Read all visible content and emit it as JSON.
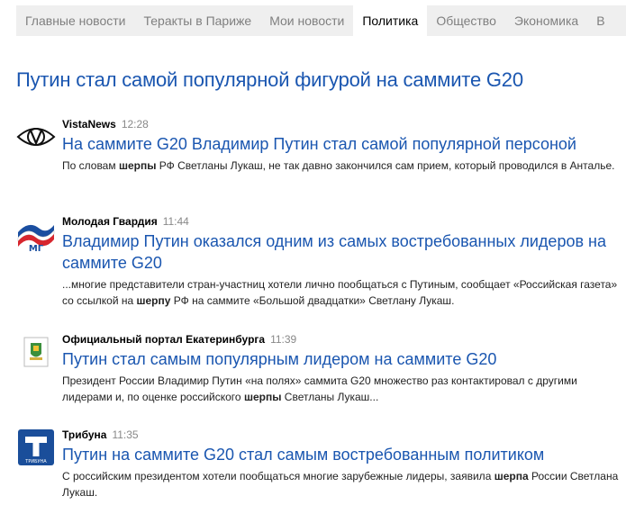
{
  "tabs": [
    {
      "label": "Главные новости",
      "active": false
    },
    {
      "label": "Теракты в Париже",
      "active": false
    },
    {
      "label": "Мои новости",
      "active": false
    },
    {
      "label": "Политика",
      "active": true
    },
    {
      "label": "Общество",
      "active": false
    },
    {
      "label": "Экономика",
      "active": false
    },
    {
      "label": "В",
      "active": false
    }
  ],
  "headline": "Путин стал самой популярной фигурой на саммите G20",
  "stories": [
    {
      "logo": "vistanews-eye-logo",
      "source": "VistaNews",
      "time": "12:28",
      "title": "На саммите G20 Владимир Путин стал самой популярной персоной",
      "snippet": {
        "a": "По словам ",
        "b": "шерпы",
        "c": " РФ Светланы Лукаш, не так давно закончился сам прием, который проводился в Анталье."
      }
    },
    {
      "logo": "molodaya-gvardiya-logo",
      "source": "Молодая Гвардия",
      "time": "11:44",
      "title": "Владимир Путин оказался одним из самых востребованных лидеров на саммите G20",
      "snippet": {
        "a": "...многие представители стран-участниц хотели лично пообщаться с Путиным, сообщает «Российская газета» со ссылкой на ",
        "b": "шерпу",
        "c": " РФ на саммите «Большой двадцатки» Светлану Лукаш."
      }
    },
    {
      "logo": "ekaterinburg-coat-of-arms-logo",
      "source": "Официальный портал Екатеринбурга",
      "time": "11:39",
      "title": "Путин стал самым популярным лидером на саммите G20",
      "snippet": {
        "a": "Президент России Владимир Путин «на полях» саммита G20 множество раз контактировал с другими лидерами и, по оценке российского ",
        "b": "шерпы",
        "c": " Светланы Лукаш..."
      }
    },
    {
      "logo": "tribuna-logo",
      "source": "Трибуна",
      "time": "11:35",
      "title": "Путин на саммите G20 стал самым востребованным политиком",
      "snippet": {
        "a": "С российским президентом хотели пообщаться многие зарубежные лидеры, заявила ",
        "b": "шерпа",
        "c": " России Светлана Лукаш."
      },
      "logo_text": "ТРИБУНА"
    }
  ],
  "colors": {
    "link": "#1a56b0",
    "tab_bar": "#efefef",
    "tab_inactive": "#7f7f7f",
    "time": "#888888",
    "tribuna_blue": "#1a4e9a"
  }
}
